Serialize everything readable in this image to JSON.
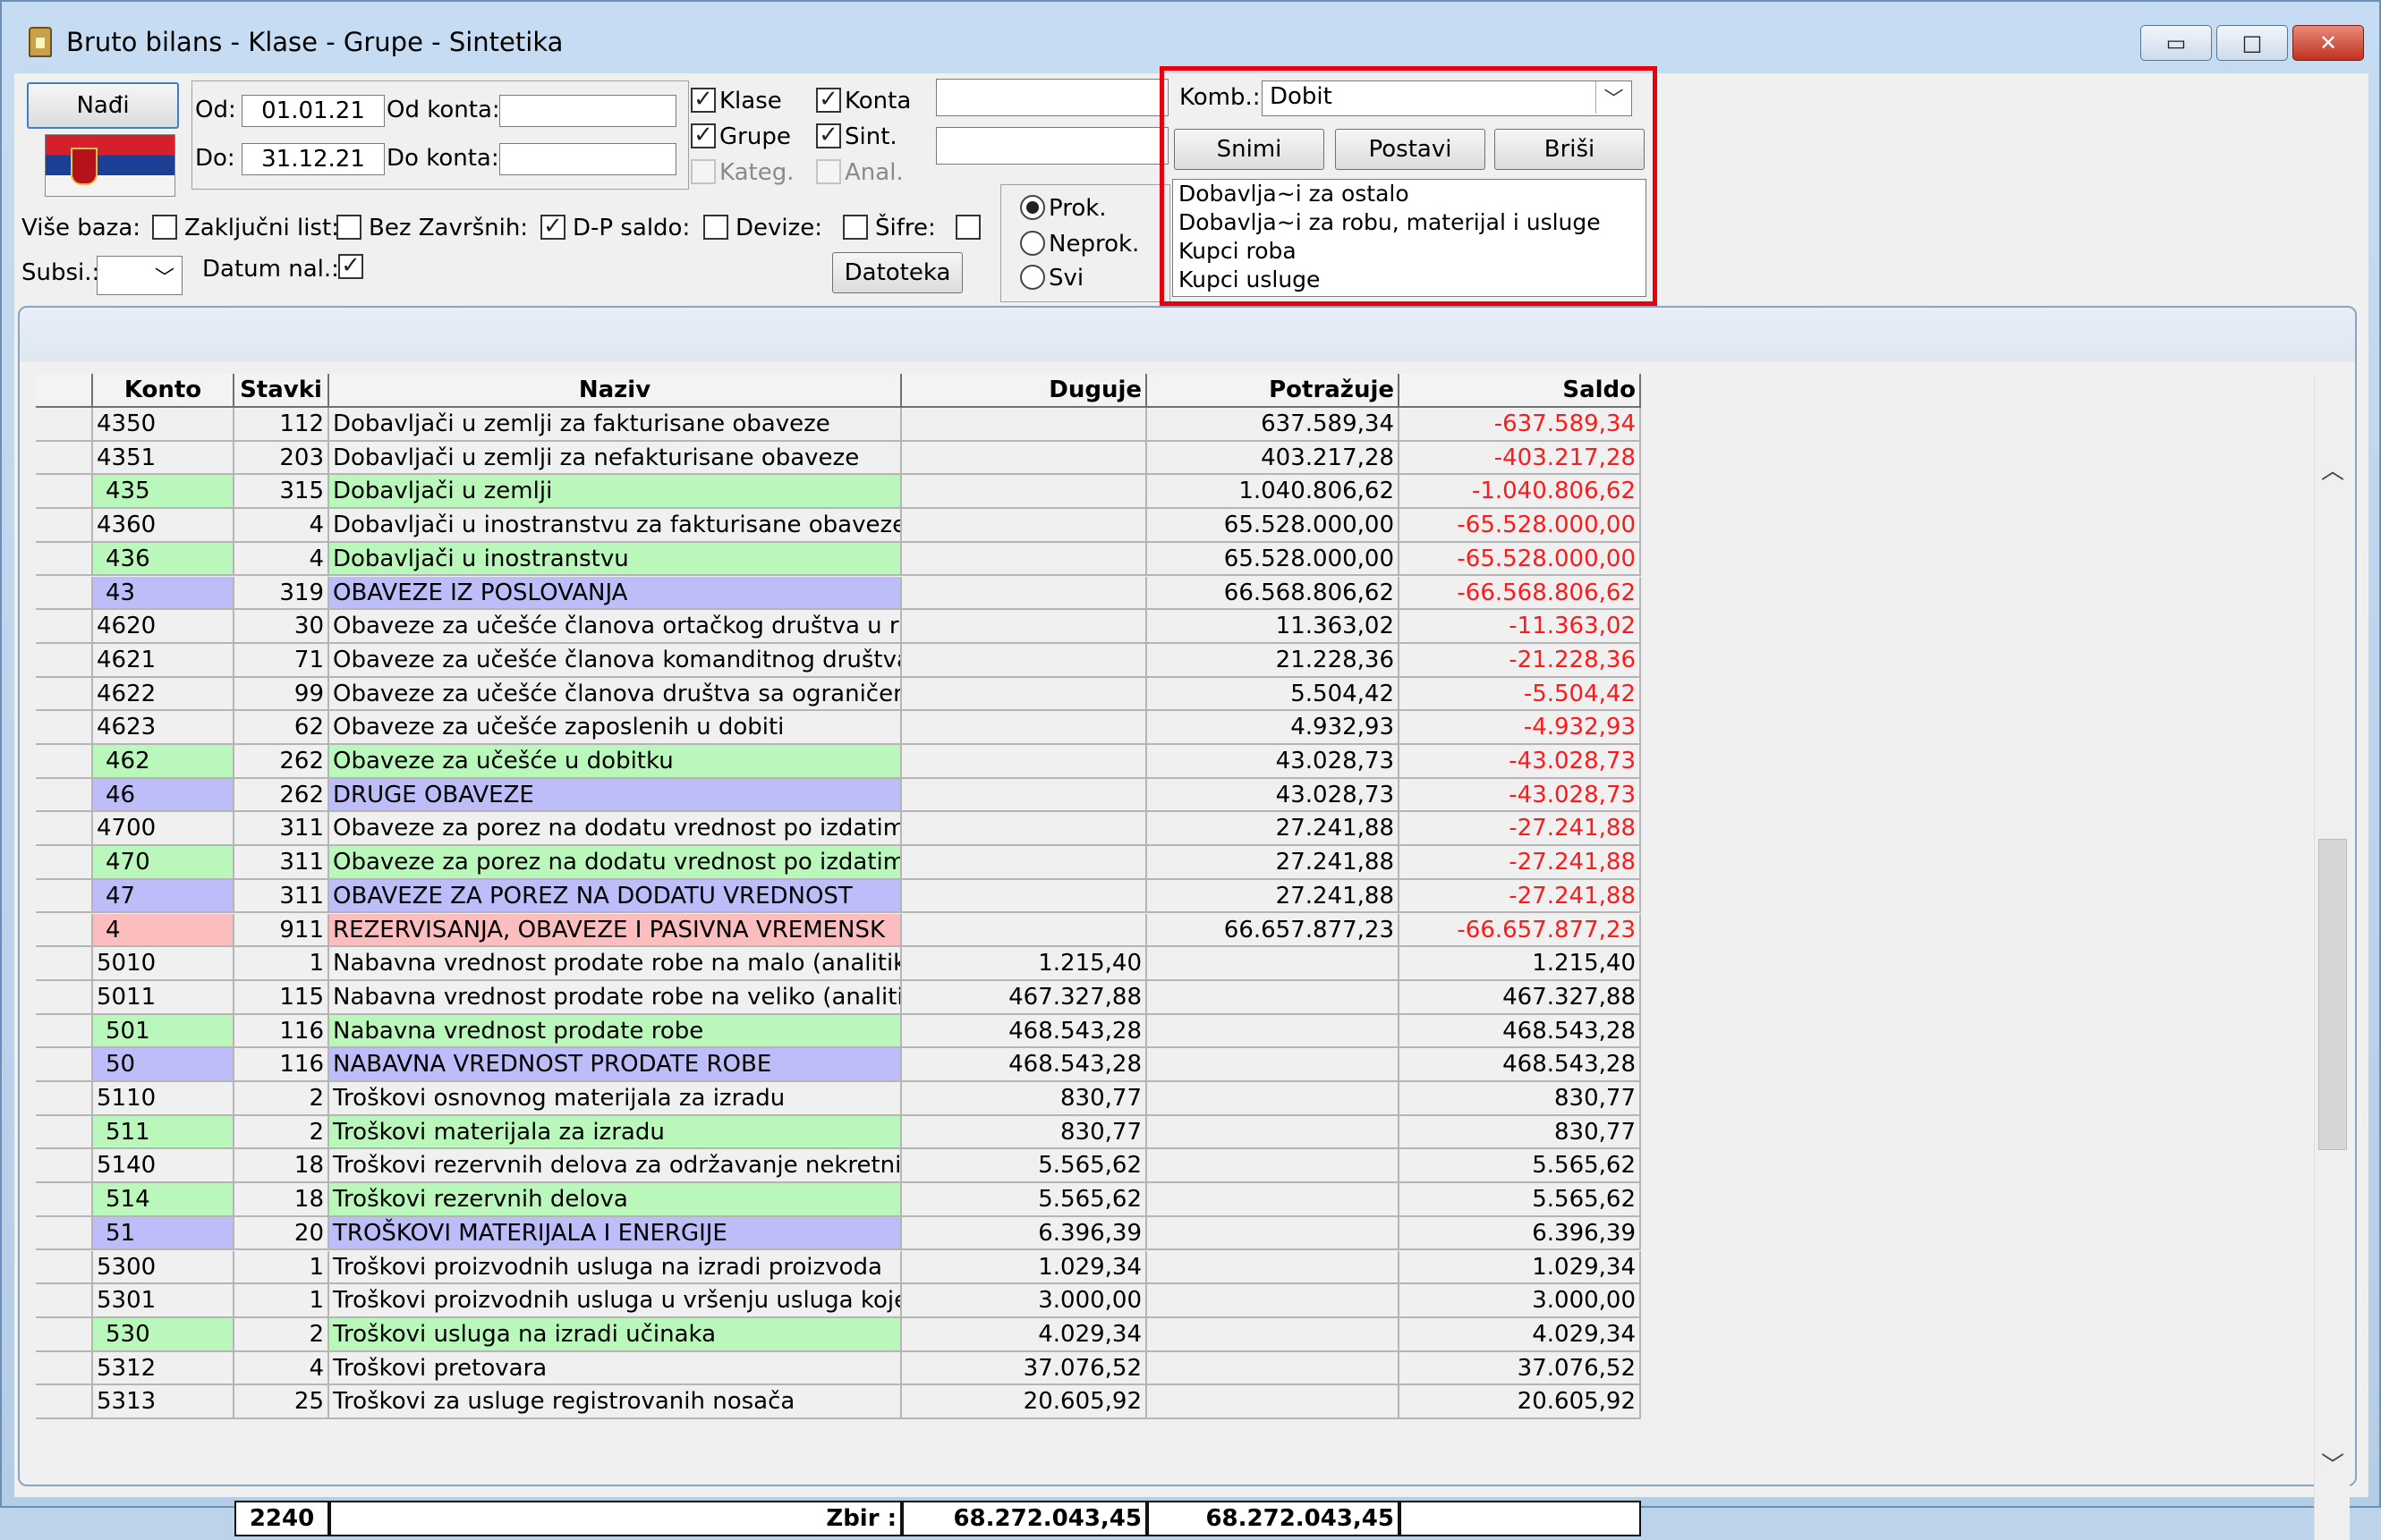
{
  "window": {
    "title": "Bruto bilans - Klase - Grupe - Sintetika",
    "controls": {
      "min": "▭",
      "max": "□",
      "close": "✕"
    }
  },
  "toolbar": {
    "find_label": "Nađi",
    "od_label": "Od:",
    "od_value": "01.01.21",
    "do_label": "Do:",
    "do_value": "31.12.21",
    "od_konta_label": "Od konta:",
    "do_konta_label": "Do konta:",
    "klase": "Klase",
    "konta": "Konta",
    "grupe": "Grupe",
    "sint": "Sint.",
    "kateg": "Kateg.",
    "anal": "Anal.",
    "vise_baza": "Više baza:",
    "zakljucni": "Zaključni list:",
    "bez_zavrsnih": "Bez Završnih:",
    "dp_saldo": "D-P saldo:",
    "devize": "Devize:",
    "sifre": "Šifre:",
    "subsi": "Subsi.:",
    "datum_nal": "Datum nal.:",
    "datoteka": "Datoteka",
    "prok": "Prok.",
    "neprok": "Neprok.",
    "svi": "Svi"
  },
  "komb": {
    "label": "Komb.:",
    "value": "Dobit",
    "snimi": "Snimi",
    "postavi": "Postavi",
    "brisi": "Briši",
    "items": [
      "Dobavlja~i za ostalo",
      "Dobavlja~i za robu, materijal i usluge",
      "Kupci roba",
      "Kupci usluge"
    ]
  },
  "grid": {
    "headers": [
      "Konto",
      "Stavki",
      "Naziv",
      "Duguje",
      "Potražuje",
      "Saldo"
    ],
    "rows": [
      {
        "konto": "4350",
        "stavki": "112",
        "naziv": "Dobavljači u zemlji za fakturisane obaveze",
        "duguje": "",
        "potrazuje": "637.589,34",
        "saldo": "-637.589,34",
        "type": ""
      },
      {
        "konto": "4351",
        "stavki": "203",
        "naziv": "Dobavljači u zemlji za nefakturisane obaveze",
        "duguje": "",
        "potrazuje": "403.217,28",
        "saldo": "-403.217,28",
        "type": ""
      },
      {
        "konto": "435",
        "stavki": "315",
        "naziv": "Dobavljači u zemlji",
        "duguje": "",
        "potrazuje": "1.040.806,62",
        "saldo": "-1.040.806,62",
        "type": "green"
      },
      {
        "konto": "4360",
        "stavki": "4",
        "naziv": "Dobavljači u inostranstvu za fakturisane obaveze",
        "duguje": "",
        "potrazuje": "65.528.000,00",
        "saldo": "-65.528.000,00",
        "type": ""
      },
      {
        "konto": "436",
        "stavki": "4",
        "naziv": "Dobavljači u inostranstvu",
        "duguje": "",
        "potrazuje": "65.528.000,00",
        "saldo": "-65.528.000,00",
        "type": "green"
      },
      {
        "konto": "43",
        "stavki": "319",
        "naziv": "OBAVEZE IZ POSLOVANJA",
        "duguje": "",
        "potrazuje": "66.568.806,62",
        "saldo": "-66.568.806,62",
        "type": "blue"
      },
      {
        "konto": "4620",
        "stavki": "30",
        "naziv": "Obaveze za učešće članova ortačkog društva u ra",
        "duguje": "",
        "potrazuje": "11.363,02",
        "saldo": "-11.363,02",
        "type": ""
      },
      {
        "konto": "4621",
        "stavki": "71",
        "naziv": "Obaveze za učešće članova komanditnog društva",
        "duguje": "",
        "potrazuje": "21.228,36",
        "saldo": "-21.228,36",
        "type": ""
      },
      {
        "konto": "4622",
        "stavki": "99",
        "naziv": "Obaveze za učešće članova društva sa ograničen",
        "duguje": "",
        "potrazuje": "5.504,42",
        "saldo": "-5.504,42",
        "type": ""
      },
      {
        "konto": "4623",
        "stavki": "62",
        "naziv": "Obaveze za učešće zaposlenih u dobiti",
        "duguje": "",
        "potrazuje": "4.932,93",
        "saldo": "-4.932,93",
        "type": ""
      },
      {
        "konto": "462",
        "stavki": "262",
        "naziv": "Obaveze za učešće u dobitku",
        "duguje": "",
        "potrazuje": "43.028,73",
        "saldo": "-43.028,73",
        "type": "green"
      },
      {
        "konto": "46",
        "stavki": "262",
        "naziv": "DRUGE OBAVEZE",
        "duguje": "",
        "potrazuje": "43.028,73",
        "saldo": "-43.028,73",
        "type": "blue"
      },
      {
        "konto": "4700",
        "stavki": "311",
        "naziv": "Obaveze za porez na dodatu vrednost po izdatim",
        "duguje": "",
        "potrazuje": "27.241,88",
        "saldo": "-27.241,88",
        "type": ""
      },
      {
        "konto": "470",
        "stavki": "311",
        "naziv": "Obaveze za porez na dodatu vrednost po izdatim",
        "duguje": "",
        "potrazuje": "27.241,88",
        "saldo": "-27.241,88",
        "type": "green"
      },
      {
        "konto": "47",
        "stavki": "311",
        "naziv": "OBAVEZE ZA POREZ NA DODATU VREDNOST",
        "duguje": "",
        "potrazuje": "27.241,88",
        "saldo": "-27.241,88",
        "type": "blue"
      },
      {
        "konto": "4",
        "stavki": "911",
        "naziv": "REZERVISANJA, OBAVEZE I PASIVNA VREMENSK",
        "duguje": "",
        "potrazuje": "66.657.877,23",
        "saldo": "-66.657.877,23",
        "type": "pink"
      },
      {
        "konto": "5010",
        "stavki": "1",
        "naziv": "Nabavna vrednost prodate robe na malo (analitik",
        "duguje": "1.215,40",
        "potrazuje": "",
        "saldo": "1.215,40",
        "type": ""
      },
      {
        "konto": "5011",
        "stavki": "115",
        "naziv": "Nabavna vrednost prodate robe na veliko (analiti",
        "duguje": "467.327,88",
        "potrazuje": "",
        "saldo": "467.327,88",
        "type": ""
      },
      {
        "konto": "501",
        "stavki": "116",
        "naziv": "Nabavna vrednost prodate robe",
        "duguje": "468.543,28",
        "potrazuje": "",
        "saldo": "468.543,28",
        "type": "green"
      },
      {
        "konto": "50",
        "stavki": "116",
        "naziv": "NABAVNA VREDNOST PRODATE ROBE",
        "duguje": "468.543,28",
        "potrazuje": "",
        "saldo": "468.543,28",
        "type": "blue"
      },
      {
        "konto": "5110",
        "stavki": "2",
        "naziv": "Troškovi osnovnog materijala za izradu",
        "duguje": "830,77",
        "potrazuje": "",
        "saldo": "830,77",
        "type": ""
      },
      {
        "konto": "511",
        "stavki": "2",
        "naziv": "Troškovi materijala za izradu",
        "duguje": "830,77",
        "potrazuje": "",
        "saldo": "830,77",
        "type": "green"
      },
      {
        "konto": "5140",
        "stavki": "18",
        "naziv": "Troškovi rezervnih delova za održavanje nekretni",
        "duguje": "5.565,62",
        "potrazuje": "",
        "saldo": "5.565,62",
        "type": ""
      },
      {
        "konto": "514",
        "stavki": "18",
        "naziv": "Troškovi rezervnih delova",
        "duguje": "5.565,62",
        "potrazuje": "",
        "saldo": "5.565,62",
        "type": "green"
      },
      {
        "konto": "51",
        "stavki": "20",
        "naziv": "TROŠKOVI MATERIJALA I ENERGIJE",
        "duguje": "6.396,39",
        "potrazuje": "",
        "saldo": "6.396,39",
        "type": "blue"
      },
      {
        "konto": "5300",
        "stavki": "1",
        "naziv": "Troškovi proizvodnih usluga na izradi proizvoda",
        "duguje": "1.029,34",
        "potrazuje": "",
        "saldo": "1.029,34",
        "type": ""
      },
      {
        "konto": "5301",
        "stavki": "1",
        "naziv": "Troškovi proizvodnih usluga u vršenju usluga koje",
        "duguje": "3.000,00",
        "potrazuje": "",
        "saldo": "3.000,00",
        "type": ""
      },
      {
        "konto": "530",
        "stavki": "2",
        "naziv": "Troškovi usluga na izradi učinaka",
        "duguje": "4.029,34",
        "potrazuje": "",
        "saldo": "4.029,34",
        "type": "green"
      },
      {
        "konto": "5312",
        "stavki": "4",
        "naziv": "Troškovi pretovara",
        "duguje": "37.076,52",
        "potrazuje": "",
        "saldo": "37.076,52",
        "type": ""
      },
      {
        "konto": "5313",
        "stavki": "25",
        "naziv": "Troškovi za usluge registrovanih nosača",
        "duguje": "20.605,92",
        "potrazuje": "",
        "saldo": "20.605,92",
        "type": ""
      }
    ],
    "footer": {
      "stavki": "2240",
      "label": "Zbir :",
      "duguje": "68.272.043,45",
      "potrazuje": "68.272.043,45",
      "saldo": ""
    }
  },
  "scroll": {
    "up": "︿",
    "down": "﹀"
  }
}
